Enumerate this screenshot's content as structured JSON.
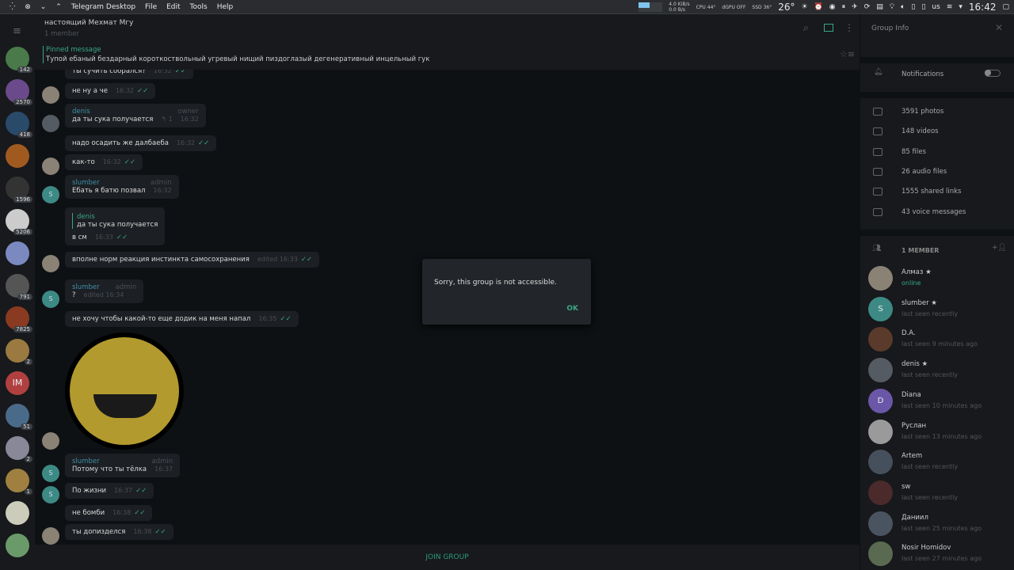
{
  "topbar": {
    "app": "Telegram Desktop",
    "menus": [
      "File",
      "Edit",
      "Tools",
      "Help"
    ],
    "net_down": "4.0 KiB/s",
    "net_up": "0.0 B/s",
    "cpu_label": "CPU",
    "cpu": "44°",
    "dgpu_label": "dGPU",
    "dgpu": "OFF",
    "ssd_label": "SSD",
    "ssd": "36°",
    "weather": "26°",
    "kbd": "us",
    "clock": "16:42"
  },
  "sidebar": {
    "badges": [
      "142",
      "2570",
      "418",
      "",
      "1596",
      "5206",
      "",
      "791",
      "7825",
      "2",
      "",
      "51",
      "2",
      "1",
      "",
      ""
    ],
    "initials": "IM"
  },
  "header": {
    "title": "настоящий Мехмат Мгу",
    "subtitle": "1 member",
    "pinned_label": "Pinned message",
    "pinned_text": "Тупой ебаный бездарный короткоствольный угревый нищий пиздоглазый дегенеративный инцельный гук"
  },
  "messages": [
    {
      "text": "ты сучить собрался?",
      "time": "16:32"
    },
    {
      "text": "не ну а че",
      "time": "16:32"
    },
    {
      "name": "denis",
      "role": "owner",
      "text": "да ты сука получается",
      "replies": "↰ 1",
      "time": "16:32"
    },
    {
      "text": "надо осадить же далбаеба",
      "time": "16:32"
    },
    {
      "text": "как-то",
      "time": "16:32"
    },
    {
      "name": "slumber",
      "role": "admin",
      "text": "Ебать я батю позвал",
      "time": "16:32"
    },
    {
      "quote_name": "denis",
      "quote_text": "да ты сука получается",
      "text": "в см",
      "time": "16:33"
    },
    {
      "text": "вполне норм реакция инстинкта самосохранения",
      "time": "edited 16:33"
    },
    {
      "name": "slumber",
      "role": "admin",
      "text": "?",
      "time": "edited 16:34"
    },
    {
      "text": "не хочу чтобы какой-то еще додик на меня напал",
      "time": "16:35"
    },
    {
      "name": "slumber",
      "role": "admin",
      "text": "Потому что ты тёлка",
      "time": "16:37"
    },
    {
      "text": "По жизни",
      "time": "16:37"
    },
    {
      "text": "не бомби",
      "time": "16:38"
    },
    {
      "text": "ты допизделся",
      "time": "16:38"
    }
  ],
  "compose": {
    "join": "JOIN GROUP"
  },
  "dialog": {
    "text": "Sorry, this group is not accessible.",
    "ok": "OK"
  },
  "info": {
    "title": "Group Info",
    "notifications": "Notifications",
    "media": [
      "3591 photos",
      "148 videos",
      "85 files",
      "26 audio files",
      "1555 shared links",
      "43 voice messages"
    ],
    "members_header": "1 MEMBER",
    "members": [
      {
        "name": "Алмаз ★",
        "status": "online",
        "color": "#8a8275"
      },
      {
        "name": "slumber ★",
        "status": "last seen recently",
        "color": "#3d8a85",
        "init": "S"
      },
      {
        "name": "D.A.",
        "status": "last seen 9 minutes ago",
        "color": "#5a3a2a"
      },
      {
        "name": "denis ★",
        "status": "last seen recently",
        "color": "#555b62"
      },
      {
        "name": "Diana",
        "status": "last seen 10 minutes ago",
        "color": "#6a57a8",
        "init": "D"
      },
      {
        "name": "Руслан",
        "status": "last seen 13 minutes ago",
        "color": "#9a9a9a"
      },
      {
        "name": "Artem",
        "status": "last seen recently",
        "color": "#46505c"
      },
      {
        "name": "sw",
        "status": "last seen recently",
        "color": "#4a2a2a"
      },
      {
        "name": "Даниил",
        "status": "last seen 25 minutes ago",
        "color": "#4a5460"
      },
      {
        "name": "Nosir Homidov",
        "status": "last seen 27 minutes ago",
        "color": "#5a6a50"
      }
    ]
  },
  "colors": {
    "accent": "#3aa884",
    "name": "#3f8fa6"
  }
}
